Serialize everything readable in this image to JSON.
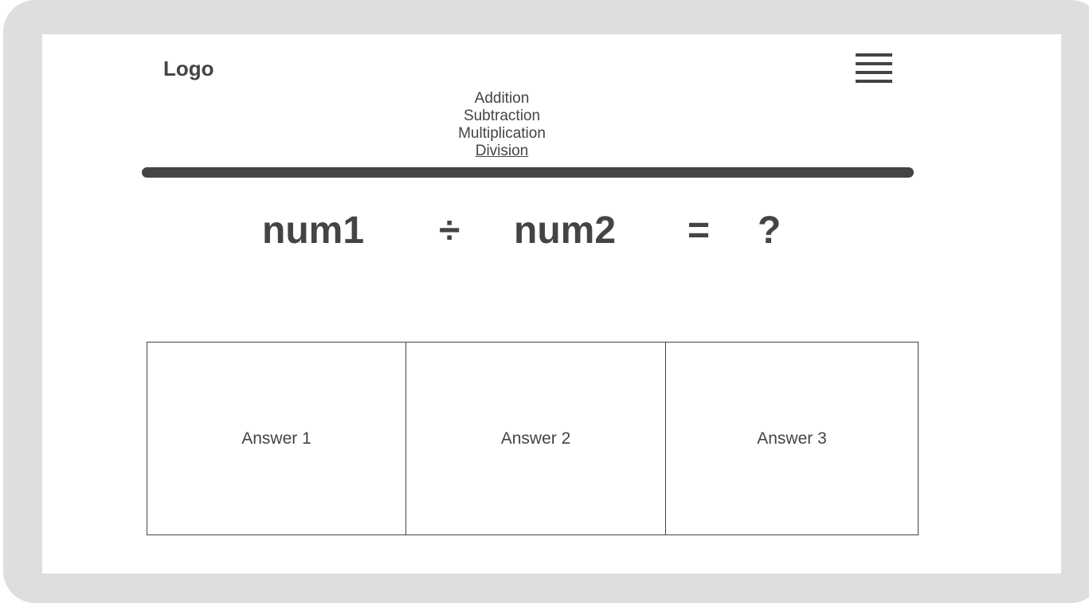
{
  "header": {
    "logo": "Logo",
    "menu_icon": "hamburger-menu-icon"
  },
  "nav": {
    "items": [
      {
        "label": "Addition",
        "active": false
      },
      {
        "label": "Subtraction",
        "active": false
      },
      {
        "label": "Multiplication",
        "active": false
      },
      {
        "label": "Division",
        "active": true
      }
    ]
  },
  "equation": {
    "operand1": "num1",
    "operator": "÷",
    "operand2": "num2",
    "equals": "=",
    "result": "?"
  },
  "answers": [
    {
      "label": "Answer 1"
    },
    {
      "label": "Answer 2"
    },
    {
      "label": "Answer 3"
    }
  ],
  "colors": {
    "frame": "#dedede",
    "ink": "#444444",
    "screen": "#ffffff"
  }
}
